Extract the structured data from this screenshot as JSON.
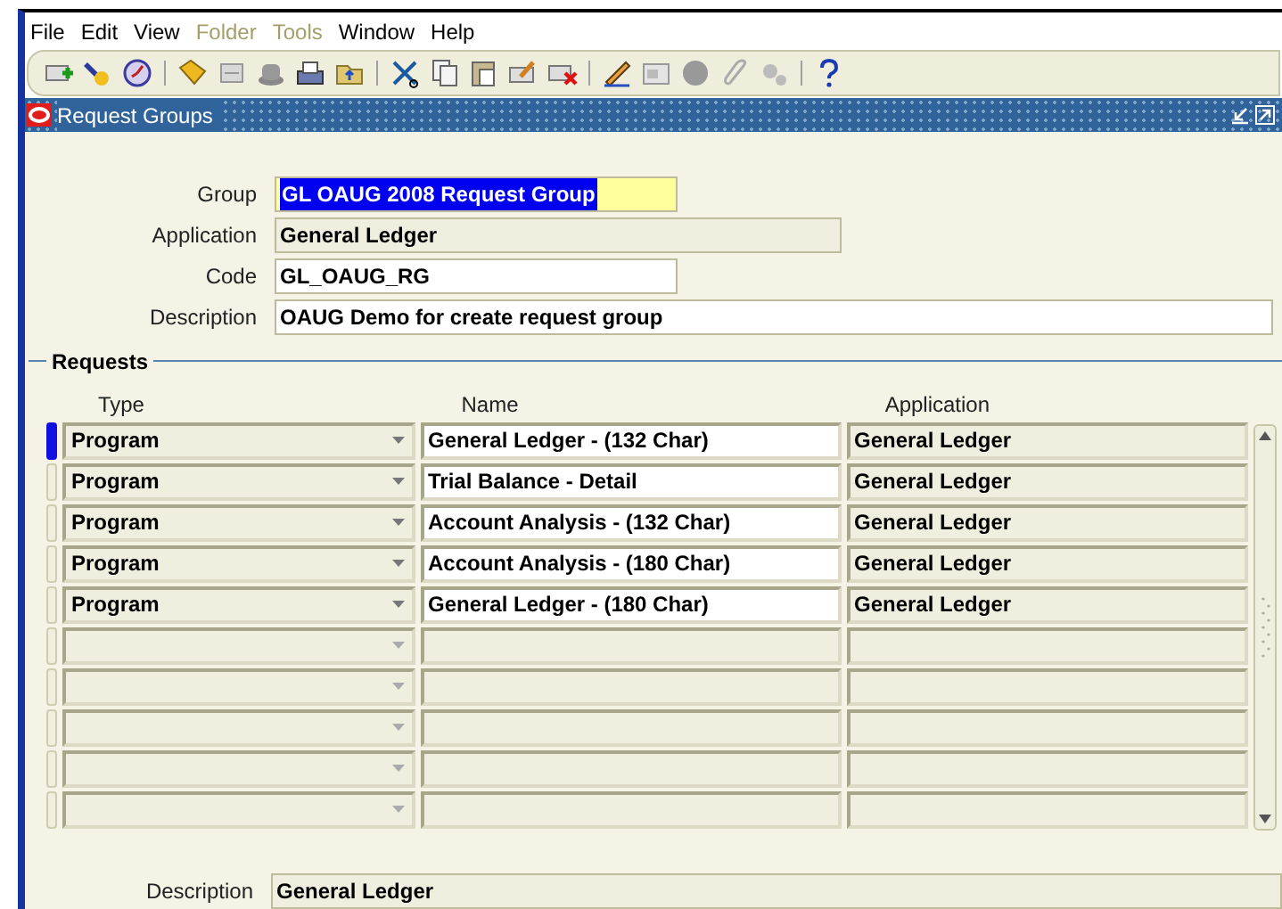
{
  "menu": [
    {
      "label": "File",
      "disabled": false
    },
    {
      "label": "Edit",
      "disabled": false
    },
    {
      "label": "View",
      "disabled": false
    },
    {
      "label": "Folder",
      "disabled": true
    },
    {
      "label": "Tools",
      "disabled": true
    },
    {
      "label": "Window",
      "disabled": false
    },
    {
      "label": "Help",
      "disabled": false
    }
  ],
  "window": {
    "title": "Request Groups"
  },
  "fields": [
    {
      "label": "Group",
      "value": "GL OAUG 2008 Request Group",
      "kind": "highlighted"
    },
    {
      "label": "Application",
      "value": "General Ledger",
      "kind": "readonly"
    },
    {
      "label": "Code",
      "value": "GL_OAUG_RG",
      "kind": "editable"
    },
    {
      "label": "Description",
      "value": "OAUG Demo for create request group",
      "kind": "editable"
    }
  ],
  "requests": {
    "title": "Requests",
    "columns": [
      "Type",
      "Name",
      "Application"
    ],
    "rows": [
      {
        "type": "Program",
        "name": "General Ledger - (132 Char)",
        "application": "General Ledger",
        "selected": true
      },
      {
        "type": "Program",
        "name": "Trial Balance - Detail",
        "application": "General Ledger",
        "selected": false
      },
      {
        "type": "Program",
        "name": "Account Analysis - (132 Char)",
        "application": "General Ledger",
        "selected": false
      },
      {
        "type": "Program",
        "name": "Account Analysis - (180 Char)",
        "application": "General Ledger",
        "selected": false
      },
      {
        "type": "Program",
        "name": "General Ledger - (180 Char)",
        "application": "General Ledger",
        "selected": false
      },
      {
        "selected": false
      },
      {
        "selected": false
      },
      {
        "selected": false
      },
      {
        "selected": false
      },
      {
        "selected": false
      }
    ]
  },
  "footer": {
    "label": "Description",
    "value": "General Ledger"
  }
}
